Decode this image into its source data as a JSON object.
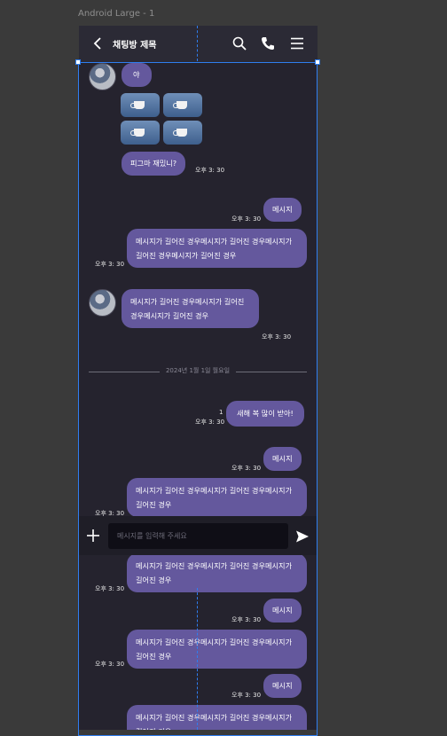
{
  "canvas": {
    "frame_label": "Android Large - 1"
  },
  "header": {
    "title": "채팅방 제목",
    "icons": [
      "back-icon",
      "search-icon",
      "call-icon",
      "menu-icon"
    ]
  },
  "messages": {
    "m1": {
      "text": "야"
    },
    "m2": {
      "text": "피그마 재밌니?",
      "time": "오후 3: 30"
    },
    "m3": {
      "text": "메시지",
      "time": "오후 3: 30"
    },
    "m4": {
      "text": "메시지가 길어진 경우메시지가 길어진 경우메시지가 길어진 경우메시지가 길어진 경우",
      "time": "오후 3: 30"
    },
    "m5": {
      "text": "메시지가 길어진 경우메시지가 길어진 경우메시지가 길어진 경우",
      "time": "오후 3: 30"
    },
    "date_divider": "2024년 1월 1일 월요일",
    "m6": {
      "text": "새해 복 많이 받아!",
      "time": "오후 3: 30",
      "unread": "1"
    },
    "m7": {
      "text": "메시지",
      "time": "오후 3: 30"
    },
    "m8": {
      "text": "메시지가 길어진 경우메시지가 길어진 경우메시지가 길어진 경우",
      "time": "오후 3: 30"
    },
    "m9": {
      "text": "메시지가 길어진 경우메시지가 길어진 경우메시지가 길어진 경우",
      "time": "오후 3: 30"
    },
    "m10": {
      "text": "메시지",
      "time": "오후 3: 30"
    },
    "m11": {
      "text": "메시지가 길어진 경우메시지가 길어진 경우메시지가 길어진 경우",
      "time": "오후 3: 30"
    },
    "m12": {
      "text": "메시지",
      "time": "오후 3: 30"
    },
    "m13": {
      "text": "메시지가 길어진 경우메시지가 길어진 경우메시지가 길어진 경우"
    }
  },
  "composer": {
    "placeholder": "메시지를 입력해 주세요",
    "value": ""
  },
  "colors": {
    "background": "#25232e",
    "header": "#2b2a35",
    "bubble": "#64589d",
    "composer": "#1f1e27",
    "input": "#0f0e16",
    "selection": "#2f7ef0"
  }
}
